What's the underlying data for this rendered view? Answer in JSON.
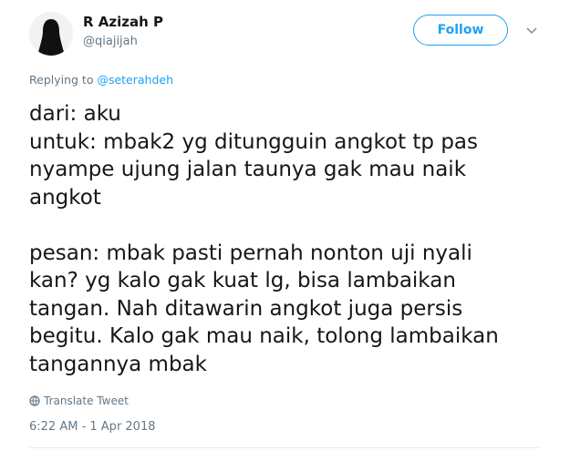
{
  "author": {
    "name": "R Azizah P",
    "handle": "@qiajijah"
  },
  "follow_label": "Follow",
  "reply": {
    "prefix": "Replying to ",
    "to": "@seterahdeh"
  },
  "tweet_text": "dari: aku\nuntuk: mbak2 yg ditungguin angkot tp pas\nnyampe ujung jalan taunya gak mau naik\nangkot\n\npesan: mbak pasti pernah nonton uji nyali\nkan? yg kalo gak kuat lg, bisa lambaikan\ntangan. Nah ditawarin angkot juga persis\nbegitu. Kalo gak mau naik, tolong lambaikan\ntangannya mbak",
  "translate_label": "Translate Tweet",
  "timestamp": "6:22 AM - 1 Apr 2018",
  "icons": {
    "avatar": "silhouette-avatar",
    "menu": "chevron-down-icon",
    "translate": "globe-icon"
  },
  "colors": {
    "accent": "#1da1f2",
    "muted": "#657786",
    "text": "#14171a"
  }
}
